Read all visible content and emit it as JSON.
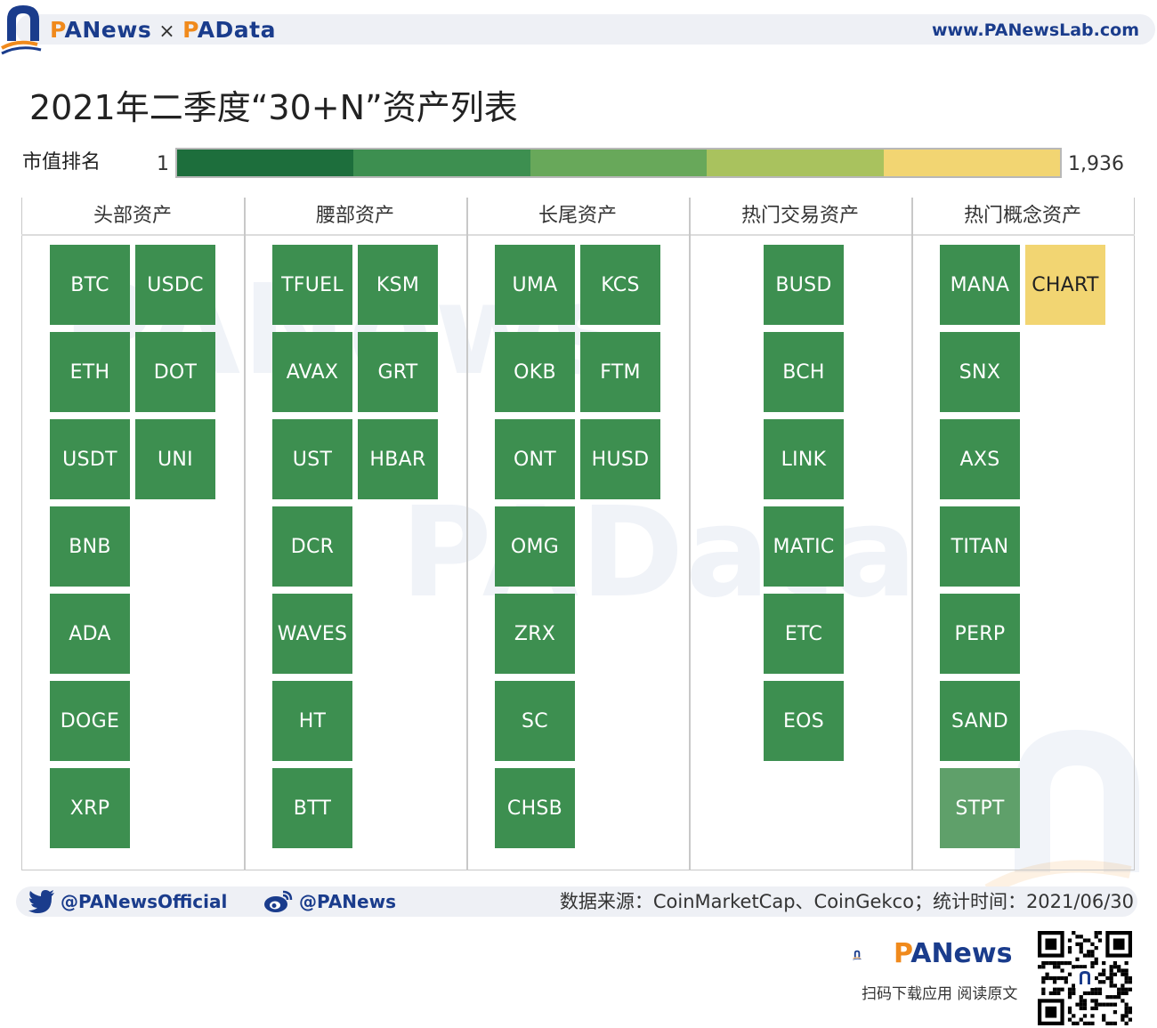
{
  "header": {
    "brand_left": "PANews",
    "brand_times": "×",
    "brand_right": "PAData",
    "url": "www.PANewsLab.com"
  },
  "title": "2021年二季度“30+N”资产列表",
  "legend": {
    "label": "市值排名",
    "min": "1",
    "max": "1,936",
    "colors": [
      "#1d6e3c",
      "#3d8f50",
      "#68a85a",
      "#a9c25e",
      "#f2d572"
    ]
  },
  "colors": {
    "tile_default": "#3d8f50",
    "tile_light": "#5fa06a",
    "tile_yellow": "#f2d572",
    "brand_blue": "#1a3c8c",
    "brand_orange": "#f08a1c"
  },
  "columns": [
    {
      "header": "头部资产",
      "tiles": [
        {
          "label": "BTC",
          "row": 0,
          "col": 0,
          "color": "#3d8f50"
        },
        {
          "label": "USDC",
          "row": 0,
          "col": 1,
          "color": "#3d8f50"
        },
        {
          "label": "ETH",
          "row": 1,
          "col": 0,
          "color": "#3d8f50"
        },
        {
          "label": "DOT",
          "row": 1,
          "col": 1,
          "color": "#3d8f50"
        },
        {
          "label": "USDT",
          "row": 2,
          "col": 0,
          "color": "#3d8f50"
        },
        {
          "label": "UNI",
          "row": 2,
          "col": 1,
          "color": "#3d8f50"
        },
        {
          "label": "BNB",
          "row": 3,
          "col": 0,
          "color": "#3d8f50"
        },
        {
          "label": "ADA",
          "row": 4,
          "col": 0,
          "color": "#3d8f50"
        },
        {
          "label": "DOGE",
          "row": 5,
          "col": 0,
          "color": "#3d8f50"
        },
        {
          "label": "XRP",
          "row": 6,
          "col": 0,
          "color": "#3d8f50"
        }
      ]
    },
    {
      "header": "腰部资产",
      "tiles": [
        {
          "label": "TFUEL",
          "row": 0,
          "col": 0,
          "color": "#3d8f50"
        },
        {
          "label": "KSM",
          "row": 0,
          "col": 1,
          "color": "#3d8f50"
        },
        {
          "label": "AVAX",
          "row": 1,
          "col": 0,
          "color": "#3d8f50"
        },
        {
          "label": "GRT",
          "row": 1,
          "col": 1,
          "color": "#3d8f50"
        },
        {
          "label": "UST",
          "row": 2,
          "col": 0,
          "color": "#3d8f50"
        },
        {
          "label": "HBAR",
          "row": 2,
          "col": 1,
          "color": "#3d8f50"
        },
        {
          "label": "DCR",
          "row": 3,
          "col": 0,
          "color": "#3d8f50"
        },
        {
          "label": "WAVES",
          "row": 4,
          "col": 0,
          "color": "#3d8f50"
        },
        {
          "label": "HT",
          "row": 5,
          "col": 0,
          "color": "#3d8f50"
        },
        {
          "label": "BTT",
          "row": 6,
          "col": 0,
          "color": "#3d8f50"
        }
      ]
    },
    {
      "header": "长尾资产",
      "tiles": [
        {
          "label": "UMA",
          "row": 0,
          "col": 0,
          "color": "#3d8f50"
        },
        {
          "label": "KCS",
          "row": 0,
          "col": 1,
          "color": "#3d8f50"
        },
        {
          "label": "OKB",
          "row": 1,
          "col": 0,
          "color": "#3d8f50"
        },
        {
          "label": "FTM",
          "row": 1,
          "col": 1,
          "color": "#3d8f50"
        },
        {
          "label": "ONT",
          "row": 2,
          "col": 0,
          "color": "#3d8f50"
        },
        {
          "label": "HUSD",
          "row": 2,
          "col": 1,
          "color": "#3d8f50"
        },
        {
          "label": "OMG",
          "row": 3,
          "col": 0,
          "color": "#3d8f50"
        },
        {
          "label": "ZRX",
          "row": 4,
          "col": 0,
          "color": "#3d8f50"
        },
        {
          "label": "SC",
          "row": 5,
          "col": 0,
          "color": "#3d8f50"
        },
        {
          "label": "CHSB",
          "row": 6,
          "col": 0,
          "color": "#3d8f50"
        }
      ]
    },
    {
      "header": "热门交易资产",
      "tiles": [
        {
          "label": "BUSD",
          "row": 0,
          "col": 0,
          "color": "#3d8f50"
        },
        {
          "label": "BCH",
          "row": 1,
          "col": 0,
          "color": "#3d8f50"
        },
        {
          "label": "LINK",
          "row": 2,
          "col": 0,
          "color": "#3d8f50"
        },
        {
          "label": "MATIC",
          "row": 3,
          "col": 0,
          "color": "#3d8f50"
        },
        {
          "label": "ETC",
          "row": 4,
          "col": 0,
          "color": "#3d8f50"
        },
        {
          "label": "EOS",
          "row": 5,
          "col": 0,
          "color": "#3d8f50"
        }
      ]
    },
    {
      "header": "热门概念资产",
      "tiles": [
        {
          "label": "MANA",
          "row": 0,
          "col": 0,
          "color": "#3d8f50"
        },
        {
          "label": "CHART",
          "row": 0,
          "col": 1,
          "color": "#f2d572",
          "dark": true
        },
        {
          "label": "SNX",
          "row": 1,
          "col": 0,
          "color": "#3d8f50"
        },
        {
          "label": "AXS",
          "row": 2,
          "col": 0,
          "color": "#3d8f50"
        },
        {
          "label": "TITAN",
          "row": 3,
          "col": 0,
          "color": "#3d8f50"
        },
        {
          "label": "PERP",
          "row": 4,
          "col": 0,
          "color": "#3d8f50"
        },
        {
          "label": "SAND",
          "row": 5,
          "col": 0,
          "color": "#3d8f50"
        },
        {
          "label": "STPT",
          "row": 6,
          "col": 0,
          "color": "#5fa06a"
        }
      ]
    }
  ],
  "footer": {
    "twitter": "@PANewsOfficial",
    "weibo": "@PANews",
    "source": "数据来源：CoinMarketCap、CoinGekco；统计时间：2021/06/30",
    "brand": "PANews",
    "slogan": "扫码下载应用  阅读原文",
    "watermark_top": "PANews",
    "watermark_mid": "PAData"
  }
}
